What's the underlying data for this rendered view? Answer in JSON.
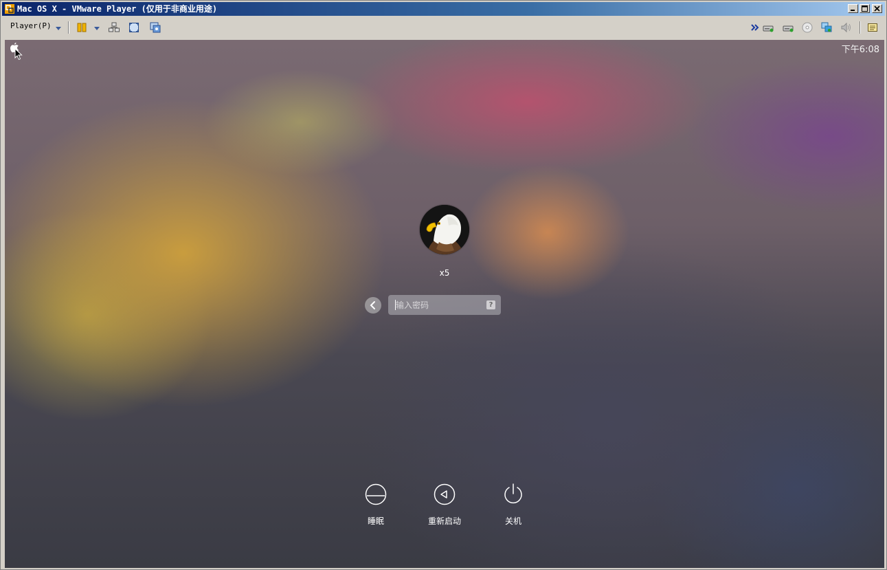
{
  "window": {
    "title": "Mac OS X - VMware Player (仅用于非商业用途)"
  },
  "toolbar": {
    "player_menu": "Player(P)",
    "left_icons": [
      "pause-icon",
      "send-ctrl-alt-del-icon",
      "fullscreen-icon",
      "unity-icon"
    ],
    "right_icons": [
      "more-chevron-icon",
      "hard-disk-icon",
      "hard-disk-2-icon",
      "cd-rom-icon",
      "network-adapter-icon",
      "sound-card-icon",
      "message-log-icon"
    ]
  },
  "vm": {
    "clock": "下午6:08",
    "user": {
      "name": "x5",
      "avatar": "bald-eagle"
    },
    "password": {
      "placeholder": "输入密码",
      "help": "?"
    },
    "actions": [
      {
        "label": "睡眠",
        "icon": "sleep-icon"
      },
      {
        "label": "重新启动",
        "icon": "restart-icon"
      },
      {
        "label": "关机",
        "icon": "shutdown-icon"
      }
    ]
  },
  "colors": {
    "titlebar_start": "#0a246a",
    "titlebar_end": "#a6caf0",
    "chrome": "#d4d0c8"
  }
}
